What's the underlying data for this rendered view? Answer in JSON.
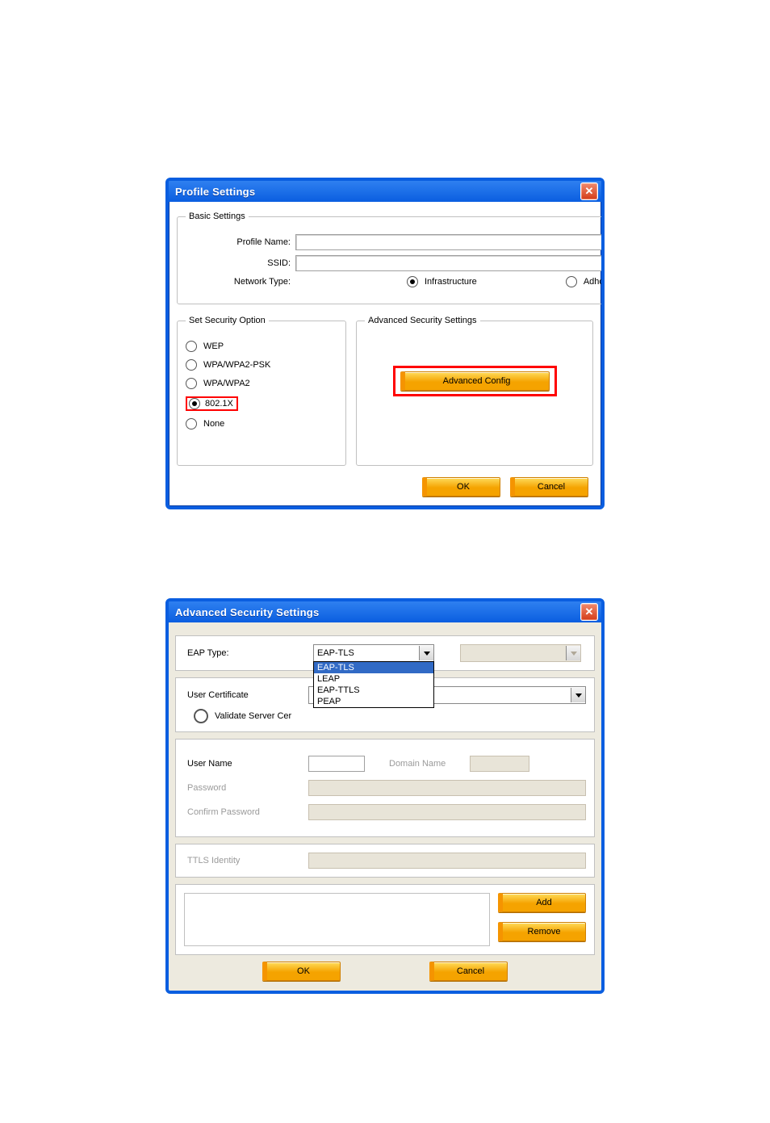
{
  "dialog1": {
    "title": "Profile Settings",
    "basic": {
      "legend": "Basic Settings",
      "profile_name_label": "Profile Name:",
      "profile_name_value": "",
      "ssid_label": "SSID:",
      "ssid_value": "",
      "network_type_label": "Network Type:",
      "nt_infra": "Infrastructure",
      "nt_adhoc": "Adhoc",
      "nt_selected": "infrastructure"
    },
    "security": {
      "legend": "Set Security Option",
      "options": {
        "wep": "WEP",
        "wpapsk": "WPA/WPA2-PSK",
        "wpa": "WPA/WPA2",
        "dot1x": "802.1X",
        "none": "None"
      },
      "selected": "dot1x"
    },
    "advanced": {
      "legend": "Advanced Security Settings",
      "button": "Advanced Config"
    },
    "ok": "OK",
    "cancel": "Cancel"
  },
  "dialog2": {
    "title": "Advanced Security Settings",
    "eap_type_label": "EAP Type:",
    "eap_type_value": "EAP-TLS",
    "eap_options": {
      "o1": "EAP-TLS",
      "o2": "LEAP",
      "o3": "EAP-TTLS",
      "o4": "PEAP"
    },
    "user_cert_label": "User Certificate",
    "validate_label": "Validate Server Cer",
    "user_name_label": "User Name",
    "domain_name_label": "Domain Name",
    "password_label": "Password",
    "confirm_password_label": "Confirm Password",
    "ttls_identity_label": "TTLS Identity",
    "add": "Add",
    "remove": "Remove",
    "ok": "OK",
    "cancel": "Cancel"
  }
}
